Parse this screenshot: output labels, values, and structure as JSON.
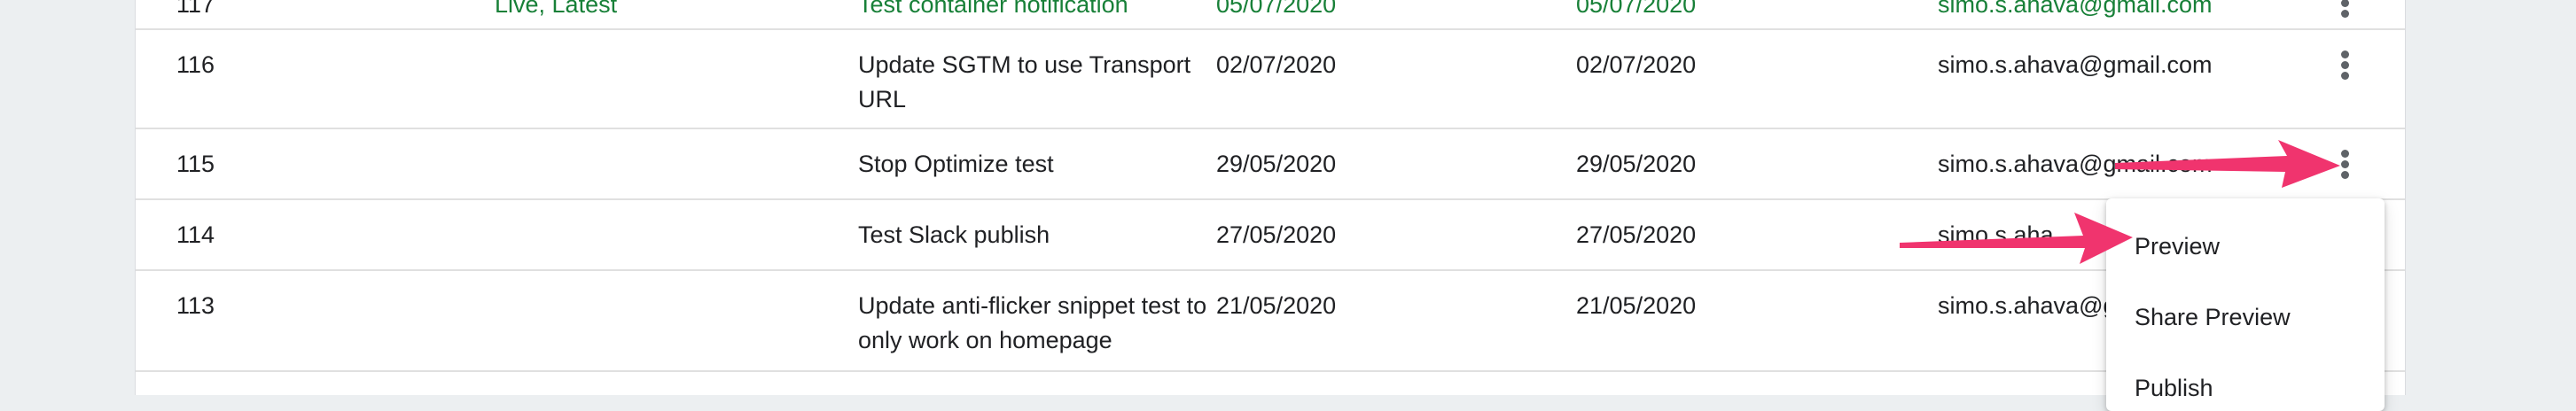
{
  "table": {
    "rows": [
      {
        "version": "117",
        "name": "Live, Latest",
        "description": "Test container notification",
        "created": "05/07/2020",
        "published": "05/07/2020",
        "published_by": "simo.s.ahava@gmail.com"
      },
      {
        "version": "116",
        "name": "",
        "description": "Update SGTM to use Transport URL",
        "created": "02/07/2020",
        "published": "02/07/2020",
        "published_by": "simo.s.ahava@gmail.com"
      },
      {
        "version": "115",
        "name": "",
        "description": "Stop Optimize test",
        "created": "29/05/2020",
        "published": "29/05/2020",
        "published_by": "simo.s.ahava@gmail.com"
      },
      {
        "version": "114",
        "name": "",
        "description": "Test Slack publish",
        "created": "27/05/2020",
        "published": "27/05/2020",
        "published_by": "simo.s.aha"
      },
      {
        "version": "113",
        "name": "",
        "description": "Update anti-flicker snippet test to only work on homepage",
        "created": "21/05/2020",
        "published": "21/05/2020",
        "published_by": "simo.s.ahava@g"
      }
    ],
    "row_actions_icon": "more-vert-icon"
  },
  "context_menu": {
    "items": [
      "Preview",
      "Share Preview",
      "Publish"
    ]
  },
  "colors": {
    "accent_green": "#188038",
    "arrow_pink": "#f0346e",
    "page_background": "#eceff1"
  }
}
